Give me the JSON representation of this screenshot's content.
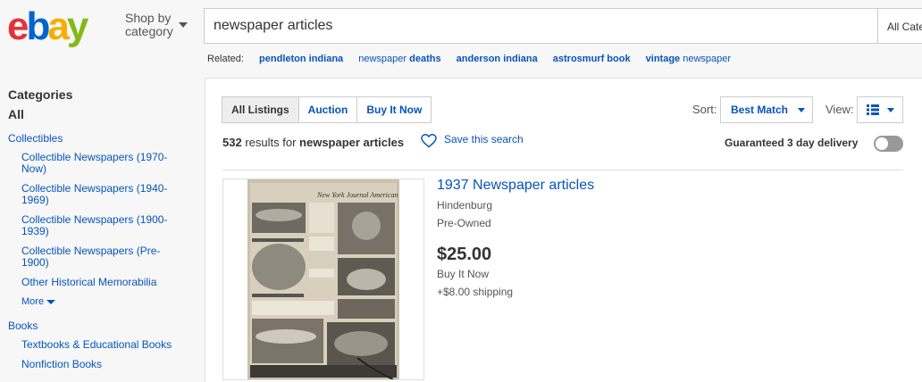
{
  "header": {
    "logo_text": "ebay",
    "shop_by": "Shop by",
    "shop_by_line2": "category",
    "search_value": "newspaper articles",
    "category_select": "All Categories"
  },
  "related": {
    "label": "Related:",
    "links": [
      "pendleton indiana",
      "newspaper deaths",
      "anderson indiana",
      "astrosmurf book",
      "vintage newspaper"
    ]
  },
  "sidebar": {
    "heading": "Categories",
    "all": "All",
    "collectibles": "Collectibles",
    "collectibles_items": [
      "Collectible Newspapers (1970-Now)",
      "Collectible Newspapers (1940-1969)",
      "Collectible Newspapers (1900-1939)",
      "Collectible Newspapers (Pre-1900)",
      "Other Historical Memorabilia"
    ],
    "more": "More",
    "books": "Books",
    "books_items": [
      "Textbooks & Educational Books",
      "Nonfiction Books"
    ]
  },
  "toolbar": {
    "tabs": [
      "All Listings",
      "Auction",
      "Buy It Now"
    ],
    "sort_label": "Sort:",
    "sort_value": "Best Match",
    "view_label": "View:",
    "results_count": "532",
    "results_text": "results for",
    "results_query": "newspaper articles",
    "save_search": "Save this search",
    "guaranteed": "Guaranteed 3 day delivery"
  },
  "item": {
    "title": "1937 Newspaper articles",
    "subtitle": "Hindenburg",
    "condition": "Pre-Owned",
    "price": "$25.00",
    "format": "Buy It Now",
    "shipping": "+$8.00 shipping",
    "image_masthead": "New York Journal American"
  },
  "colors": {
    "link": "#0654ba",
    "logo_e": "#e53238",
    "logo_b": "#0064d2",
    "logo_a": "#f5af02",
    "logo_y": "#86b817"
  }
}
